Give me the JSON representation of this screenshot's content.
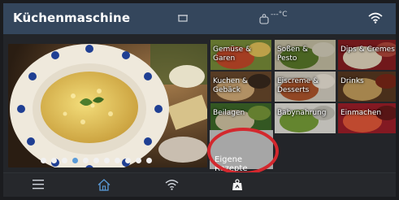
{
  "header": {
    "title": "Küchenmaschine",
    "temperature": "---°C"
  },
  "carousel": {
    "slide_count": 11,
    "active_index": 3
  },
  "tiles": [
    {
      "label": "Gemüse &\nGaren"
    },
    {
      "label": "Soßen &\nPesto"
    },
    {
      "label": "Dips & Cremes"
    },
    {
      "label": "Kuchen &\nGebäck"
    },
    {
      "label": "Eiscreme &\nDesserts"
    },
    {
      "label": "Drinks"
    },
    {
      "label": "Beilagen"
    },
    {
      "label": "Babynahrung"
    },
    {
      "label": "Einmachen"
    }
  ],
  "own_recipes": {
    "label": "Eigene Rezepte"
  },
  "colors": {
    "header": "#34465c",
    "accent": "#5a9bd8",
    "highlight_ring": "#d3282e"
  },
  "bottom_nav": [
    "menu-icon",
    "home-icon",
    "wifi-icon",
    "scale-icon"
  ]
}
